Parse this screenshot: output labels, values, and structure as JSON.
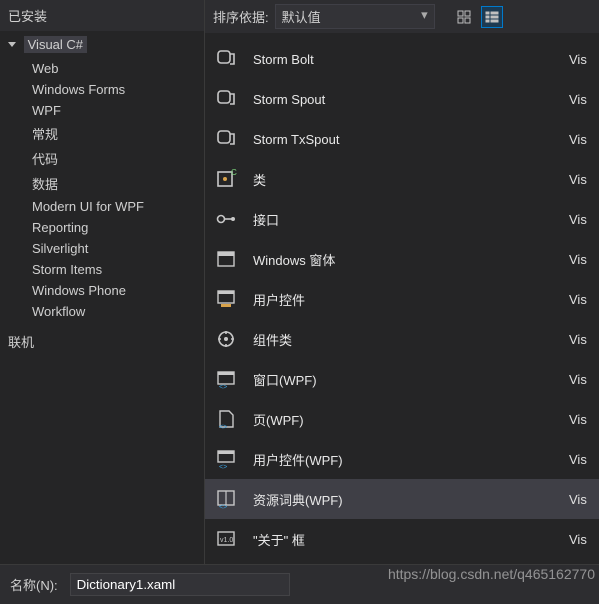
{
  "sidebar": {
    "header": "已安装",
    "root_group": "Visual C#",
    "items": [
      "Web",
      "Windows Forms",
      "WPF",
      "常规",
      "代码",
      "数据",
      "Modern UI for WPF",
      "Reporting",
      "Silverlight",
      "Storm Items",
      "Windows Phone",
      "Workflow"
    ],
    "section2": "联机"
  },
  "toolbar": {
    "sort_label": "排序依据:",
    "sort_value": "默认值"
  },
  "templates": [
    {
      "name": "Storm Bolt",
      "lang": "Vis",
      "icon": "storm"
    },
    {
      "name": "Storm Spout",
      "lang": "Vis",
      "icon": "storm"
    },
    {
      "name": "Storm TxSpout",
      "lang": "Vis",
      "icon": "storm"
    },
    {
      "name": "类",
      "lang": "Vis",
      "icon": "class"
    },
    {
      "name": "接口",
      "lang": "Vis",
      "icon": "interface"
    },
    {
      "name": "Windows 窗体",
      "lang": "Vis",
      "icon": "form"
    },
    {
      "name": "用户控件",
      "lang": "Vis",
      "icon": "usercontrol"
    },
    {
      "name": "组件类",
      "lang": "Vis",
      "icon": "component"
    },
    {
      "name": "窗口(WPF)",
      "lang": "Vis",
      "icon": "wpfwin"
    },
    {
      "name": "页(WPF)",
      "lang": "Vis",
      "icon": "wpfpage"
    },
    {
      "name": "用户控件(WPF)",
      "lang": "Vis",
      "icon": "wpfuc"
    },
    {
      "name": "资源词典(WPF)",
      "lang": "Vis",
      "icon": "resdict",
      "selected": true
    },
    {
      "name": "\"关于\" 框",
      "lang": "Vis",
      "icon": "about"
    }
  ],
  "bottom": {
    "name_label": "名称(N):",
    "name_value": "Dictionary1.xaml"
  },
  "watermark": "https://blog.csdn.net/q465162770"
}
